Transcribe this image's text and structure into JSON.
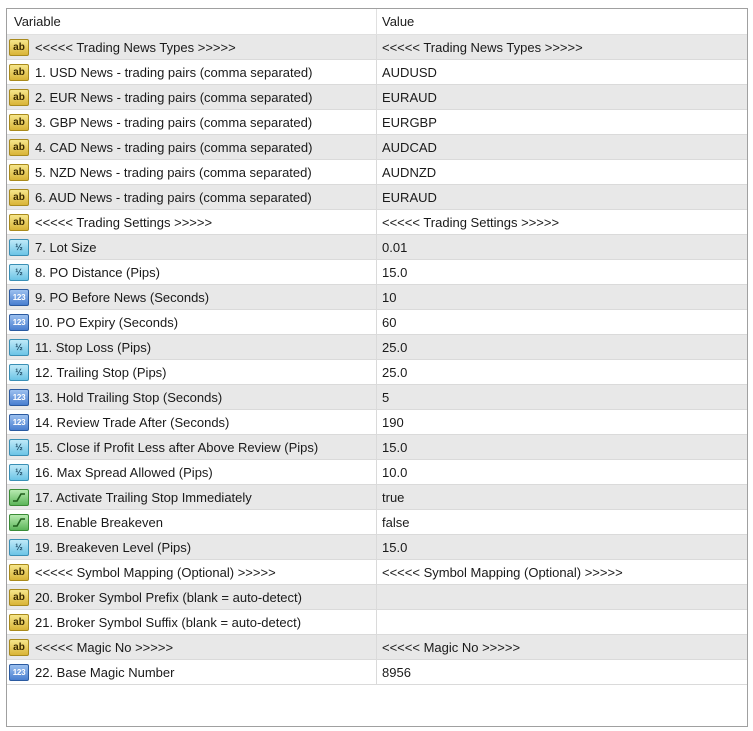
{
  "header": {
    "variable": "Variable",
    "value": "Value"
  },
  "icons": {
    "ab": "ab",
    "frac": "½",
    "num": "123"
  },
  "rows": [
    {
      "type": "ab",
      "name": "<<<<< Trading News Types >>>>>",
      "value": "<<<<< Trading News Types >>>>>"
    },
    {
      "type": "ab",
      "name": "1. USD News - trading pairs (comma separated)",
      "value": "AUDUSD"
    },
    {
      "type": "ab",
      "name": "2. EUR News - trading pairs (comma separated)",
      "value": "EURAUD"
    },
    {
      "type": "ab",
      "name": "3. GBP News - trading pairs (comma separated)",
      "value": "EURGBP"
    },
    {
      "type": "ab",
      "name": "4. CAD News - trading pairs (comma separated)",
      "value": "AUDCAD"
    },
    {
      "type": "ab",
      "name": "5. NZD News - trading pairs (comma separated)",
      "value": "AUDNZD"
    },
    {
      "type": "ab",
      "name": "6. AUD News - trading pairs (comma separated)",
      "value": "EURAUD"
    },
    {
      "type": "ab",
      "name": "<<<<< Trading Settings >>>>>",
      "value": "<<<<< Trading Settings >>>>>"
    },
    {
      "type": "frac",
      "name": "7. Lot Size",
      "value": "0.01"
    },
    {
      "type": "frac",
      "name": "8. PO Distance (Pips)",
      "value": "15.0"
    },
    {
      "type": "num",
      "name": "9. PO Before News (Seconds)",
      "value": "10"
    },
    {
      "type": "num",
      "name": "10. PO Expiry (Seconds)",
      "value": "60"
    },
    {
      "type": "frac",
      "name": "11. Stop Loss (Pips)",
      "value": "25.0"
    },
    {
      "type": "frac",
      "name": "12. Trailing Stop (Pips)",
      "value": "25.0"
    },
    {
      "type": "num",
      "name": "13. Hold Trailing Stop (Seconds)",
      "value": "5"
    },
    {
      "type": "num",
      "name": "14. Review Trade After (Seconds)",
      "value": "190"
    },
    {
      "type": "frac",
      "name": "15. Close if Profit Less after Above Review (Pips)",
      "value": "15.0"
    },
    {
      "type": "frac",
      "name": "16. Max Spread Allowed (Pips)",
      "value": "10.0"
    },
    {
      "type": "bool",
      "name": "17. Activate Trailing Stop Immediately",
      "value": "true"
    },
    {
      "type": "bool",
      "name": "18. Enable Breakeven",
      "value": "false"
    },
    {
      "type": "frac",
      "name": "19. Breakeven Level (Pips)",
      "value": "15.0"
    },
    {
      "type": "ab",
      "name": "<<<<< Symbol Mapping (Optional) >>>>>",
      "value": "<<<<< Symbol Mapping (Optional) >>>>>"
    },
    {
      "type": "ab",
      "name": "20. Broker Symbol Prefix (blank = auto-detect)",
      "value": ""
    },
    {
      "type": "ab",
      "name": "21. Broker Symbol Suffix (blank = auto-detect)",
      "value": ""
    },
    {
      "type": "ab",
      "name": "<<<<< Magic No >>>>>",
      "value": "<<<<< Magic No >>>>>"
    },
    {
      "type": "num",
      "name": "22. Base Magic Number",
      "value": "8956"
    }
  ]
}
